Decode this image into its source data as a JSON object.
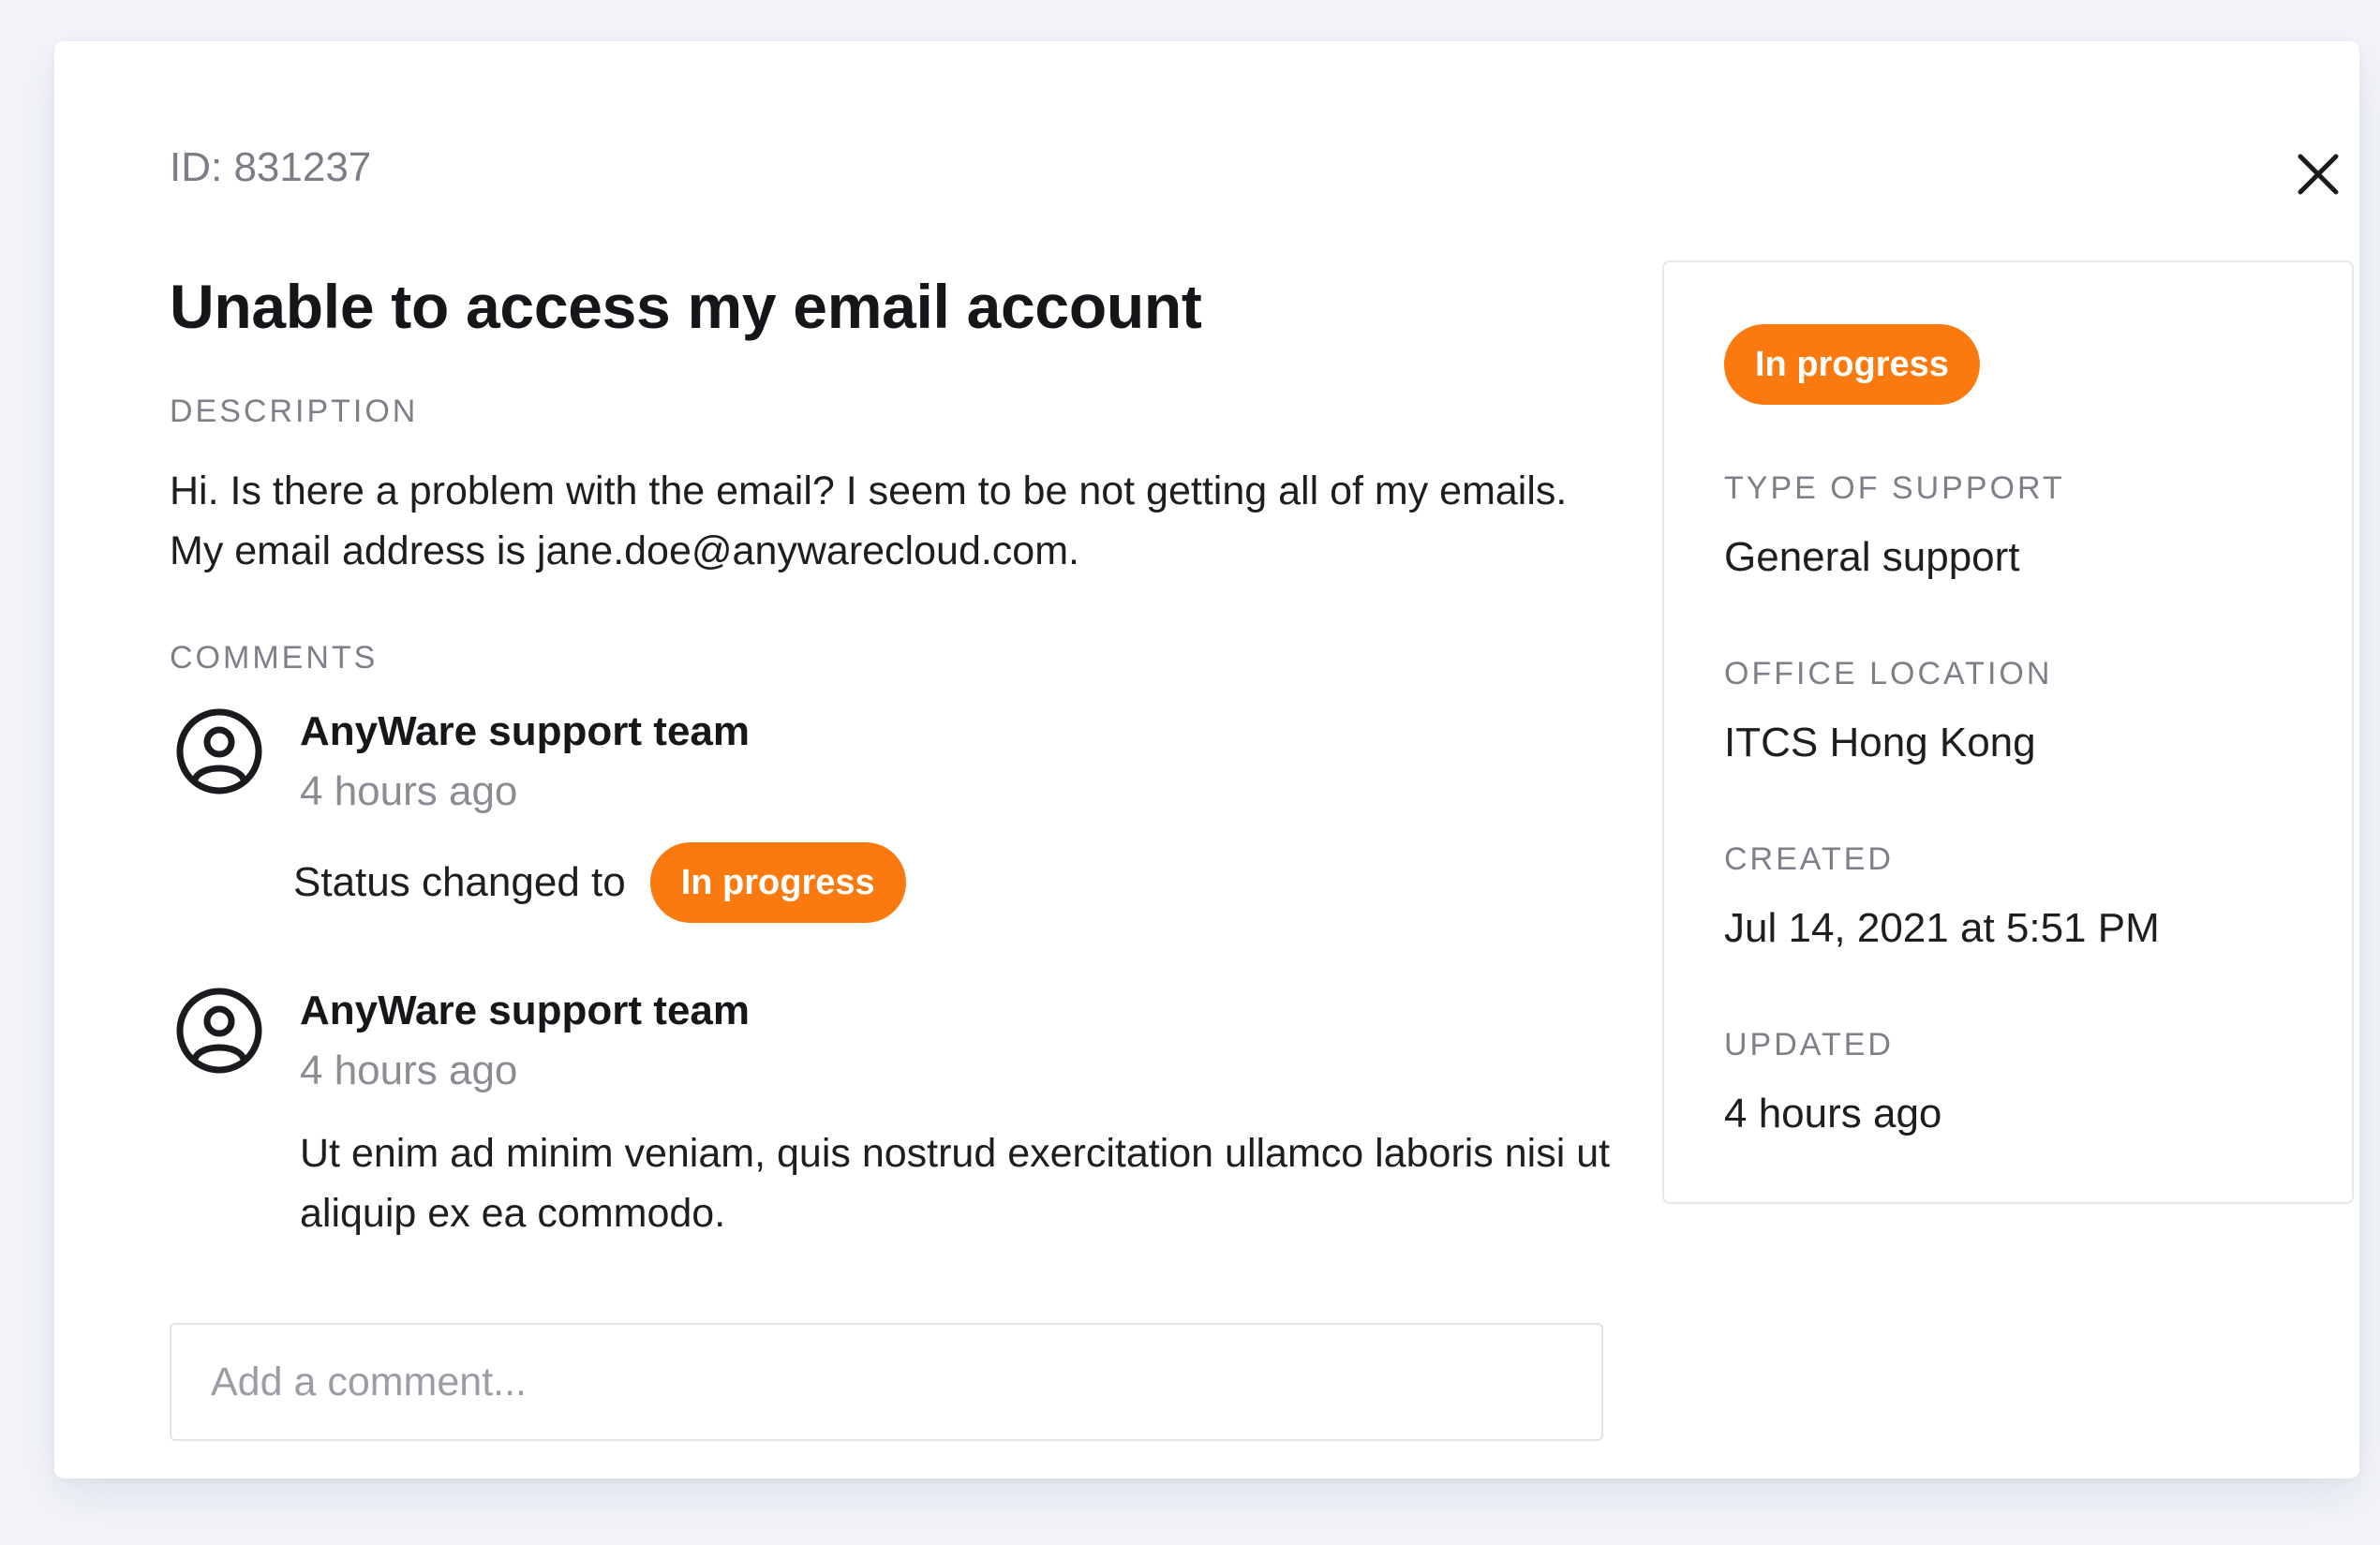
{
  "ticket": {
    "id_label": "ID: 831237",
    "title": "Unable to access my email account",
    "description_label": "DESCRIPTION",
    "description": "Hi. Is there a problem with the email? I seem to be not getting all of my emails. My email address is jane.doe@anywarecloud.com."
  },
  "comments": {
    "label": "COMMENTS",
    "items": [
      {
        "author": "AnyWare support team",
        "time": "4 hours ago",
        "status_prefix": "Status changed to",
        "status_badge": "In progress"
      },
      {
        "author": "AnyWare support team",
        "time": "4 hours ago",
        "body": "Ut enim ad minim veniam, quis nostrud exercitation ullamco laboris nisi ut aliquip ex ea commodo."
      }
    ],
    "input_placeholder": "Add a comment..."
  },
  "sidebar": {
    "status": "In progress",
    "fields": [
      {
        "label": "TYPE OF SUPPORT",
        "value": "General support"
      },
      {
        "label": "OFFICE LOCATION",
        "value": "ITCS Hong Kong"
      },
      {
        "label": "CREATED",
        "value": "Jul 14, 2021 at 5:51 PM"
      },
      {
        "label": "UPDATED",
        "value": "4 hours ago"
      }
    ]
  },
  "icons": {
    "close": "close-icon",
    "avatar": "user-circle-icon"
  },
  "colors": {
    "accent": "#fb7a0f",
    "muted": "#7d8088",
    "text": "#1d1e22",
    "border": "#e1e3e8"
  }
}
